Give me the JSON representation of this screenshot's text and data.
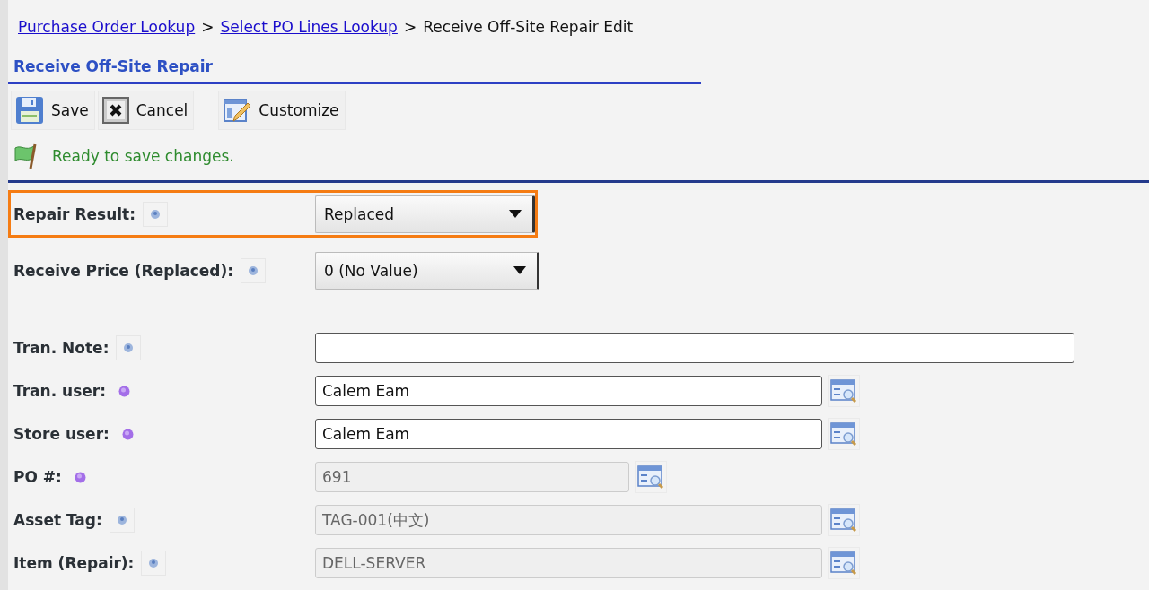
{
  "breadcrumb": [
    {
      "label": "Purchase Order Lookup",
      "kind": "link"
    },
    {
      "label": "Select PO Lines Lookup",
      "kind": "link"
    },
    {
      "label": "Receive Off-Site Repair Edit",
      "kind": "current"
    }
  ],
  "breadcrumb_separator": ">",
  "title": "Receive Off-Site Repair",
  "toolbar": [
    {
      "label": "Save",
      "kind": "save"
    },
    {
      "label": "Cancel",
      "kind": "cancel"
    },
    {
      "label": "Customize",
      "kind": "customize"
    }
  ],
  "status": {
    "message": "Ready to save changes."
  },
  "selects": [
    {
      "label": "Repair Result:",
      "required": false,
      "value": "Replaced",
      "highlighted": true
    },
    {
      "label": "Receive Price (Replaced):",
      "required": false,
      "value": "0 (No Value)",
      "highlighted": false
    }
  ],
  "fields": [
    {
      "label": "Tran. Note:",
      "required": false,
      "kind": "note",
      "disabled": false
    },
    {
      "label": "Tran. user:",
      "required": true,
      "kind": "lookup",
      "value": "Calem Eam",
      "disabled": false
    },
    {
      "label": "Store user:",
      "required": true,
      "kind": "lookup",
      "value": "Calem Eam",
      "disabled": false
    },
    {
      "label": "PO #:",
      "required": true,
      "kind": "short-lookup",
      "value": "691",
      "disabled": true
    },
    {
      "label": "Asset Tag:",
      "required": false,
      "kind": "lookup",
      "value": "TAG-001(中文)",
      "disabled": true
    },
    {
      "label": "Item (Repair):",
      "required": false,
      "kind": "lookup",
      "value": "DELL-SERVER",
      "disabled": true
    }
  ]
}
